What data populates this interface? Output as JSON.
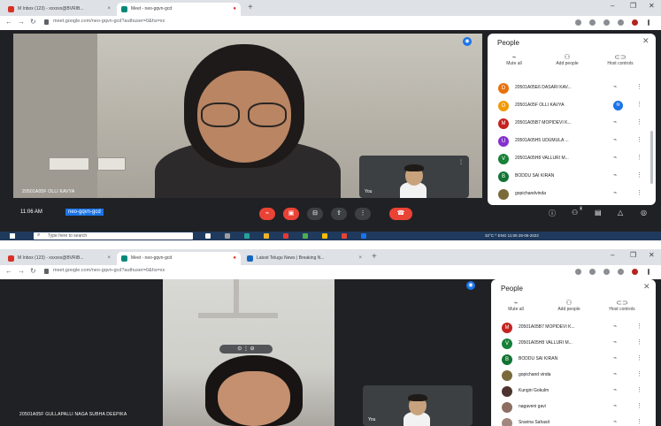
{
  "screens": [
    {
      "tabs": [
        {
          "label": "M Inbox (123) - xxxxxx@BVRIB...",
          "active": false
        },
        {
          "label": "Meet - neo-gqvn-gcd",
          "active": true
        }
      ],
      "address_url": "meet.google.com/neo-gqvn-gcd?authuser=0&hs=xx",
      "main_participant_name": "20501A05F OLLI KAVYA",
      "self_label": "You",
      "meeting_time": "11:06 AM",
      "meeting_code": "neo-gqvn-gcd",
      "people_panel": {
        "title": "People",
        "controls": [
          {
            "icon": "mic-off",
            "label": "Mute all"
          },
          {
            "icon": "add-person",
            "label": "Add people"
          },
          {
            "icon": "host-controls",
            "label": "Host controls"
          }
        ],
        "participants": [
          {
            "initial": "D",
            "color": "#e8710a",
            "name": "20501A05E6 DASARI KAV...",
            "speaking": false
          },
          {
            "initial": "O",
            "color": "#f29900",
            "name": "20501A05F OLLI KAVYA",
            "speaking": true
          },
          {
            "initial": "M",
            "color": "#c5221f",
            "name": "20501A05B7 MOPIDEVI K...",
            "speaking": false
          },
          {
            "initial": "U",
            "color": "#8430ce",
            "name": "20501A05H5 UDUMULA ...",
            "speaking": false
          },
          {
            "initial": "V",
            "color": "#188038",
            "name": "20501A05H8 VALLURI M...",
            "speaking": false
          },
          {
            "initial": "B",
            "color": "#137333",
            "name": "BODDU SAI KIRAN",
            "speaking": false
          },
          {
            "initial": "",
            "color": "#7a6a3a",
            "name": "gopichandvinda",
            "speaking": false
          }
        ]
      },
      "taskbar": {
        "search_placeholder": "Type here to search",
        "tray_text": "32°C  ^  ENG  11:06  28-06-2022"
      }
    },
    {
      "tabs": [
        {
          "label": "M Inbox (123) - xxxxxx@BVRIB...",
          "active": false
        },
        {
          "label": "Meet - neo-gqvn-gcd",
          "active": true
        },
        {
          "label": "Latest Telugu News | Breaking N...",
          "active": false
        }
      ],
      "address_url": "meet.google.com/neo-gqvn-gcd?authuser=0&hs=xx",
      "main_participant_name": "20501A05F GULLAPALLI NAGA SUBHA DEEPIKA",
      "self_label": "You",
      "people_panel": {
        "title": "People",
        "controls": [
          {
            "icon": "mic-off",
            "label": "Mute all"
          },
          {
            "icon": "add-person",
            "label": "Add people"
          },
          {
            "icon": "host-controls",
            "label": "Host controls"
          }
        ],
        "participants": [
          {
            "initial": "M",
            "color": "#c5221f",
            "name": "20501A05B7 MOPIDEVI K...",
            "speaking": false
          },
          {
            "initial": "V",
            "color": "#188038",
            "name": "20501A05H8 VALLURI M...",
            "speaking": false
          },
          {
            "initial": "B",
            "color": "#137333",
            "name": "BODDU SAI KIRAN",
            "speaking": false
          },
          {
            "initial": "",
            "color": "#7a6a3a",
            "name": "gopichand vinda",
            "speaking": false
          },
          {
            "initial": "",
            "color": "#4e342e",
            "name": "Kungiri Gokulm",
            "speaking": false
          },
          {
            "initial": "",
            "color": "#8d6e63",
            "name": "nagaveni gavi",
            "speaking": false
          },
          {
            "initial": "",
            "color": "#a1887f",
            "name": "Sravina Sahasit",
            "speaking": false
          }
        ]
      }
    }
  ]
}
